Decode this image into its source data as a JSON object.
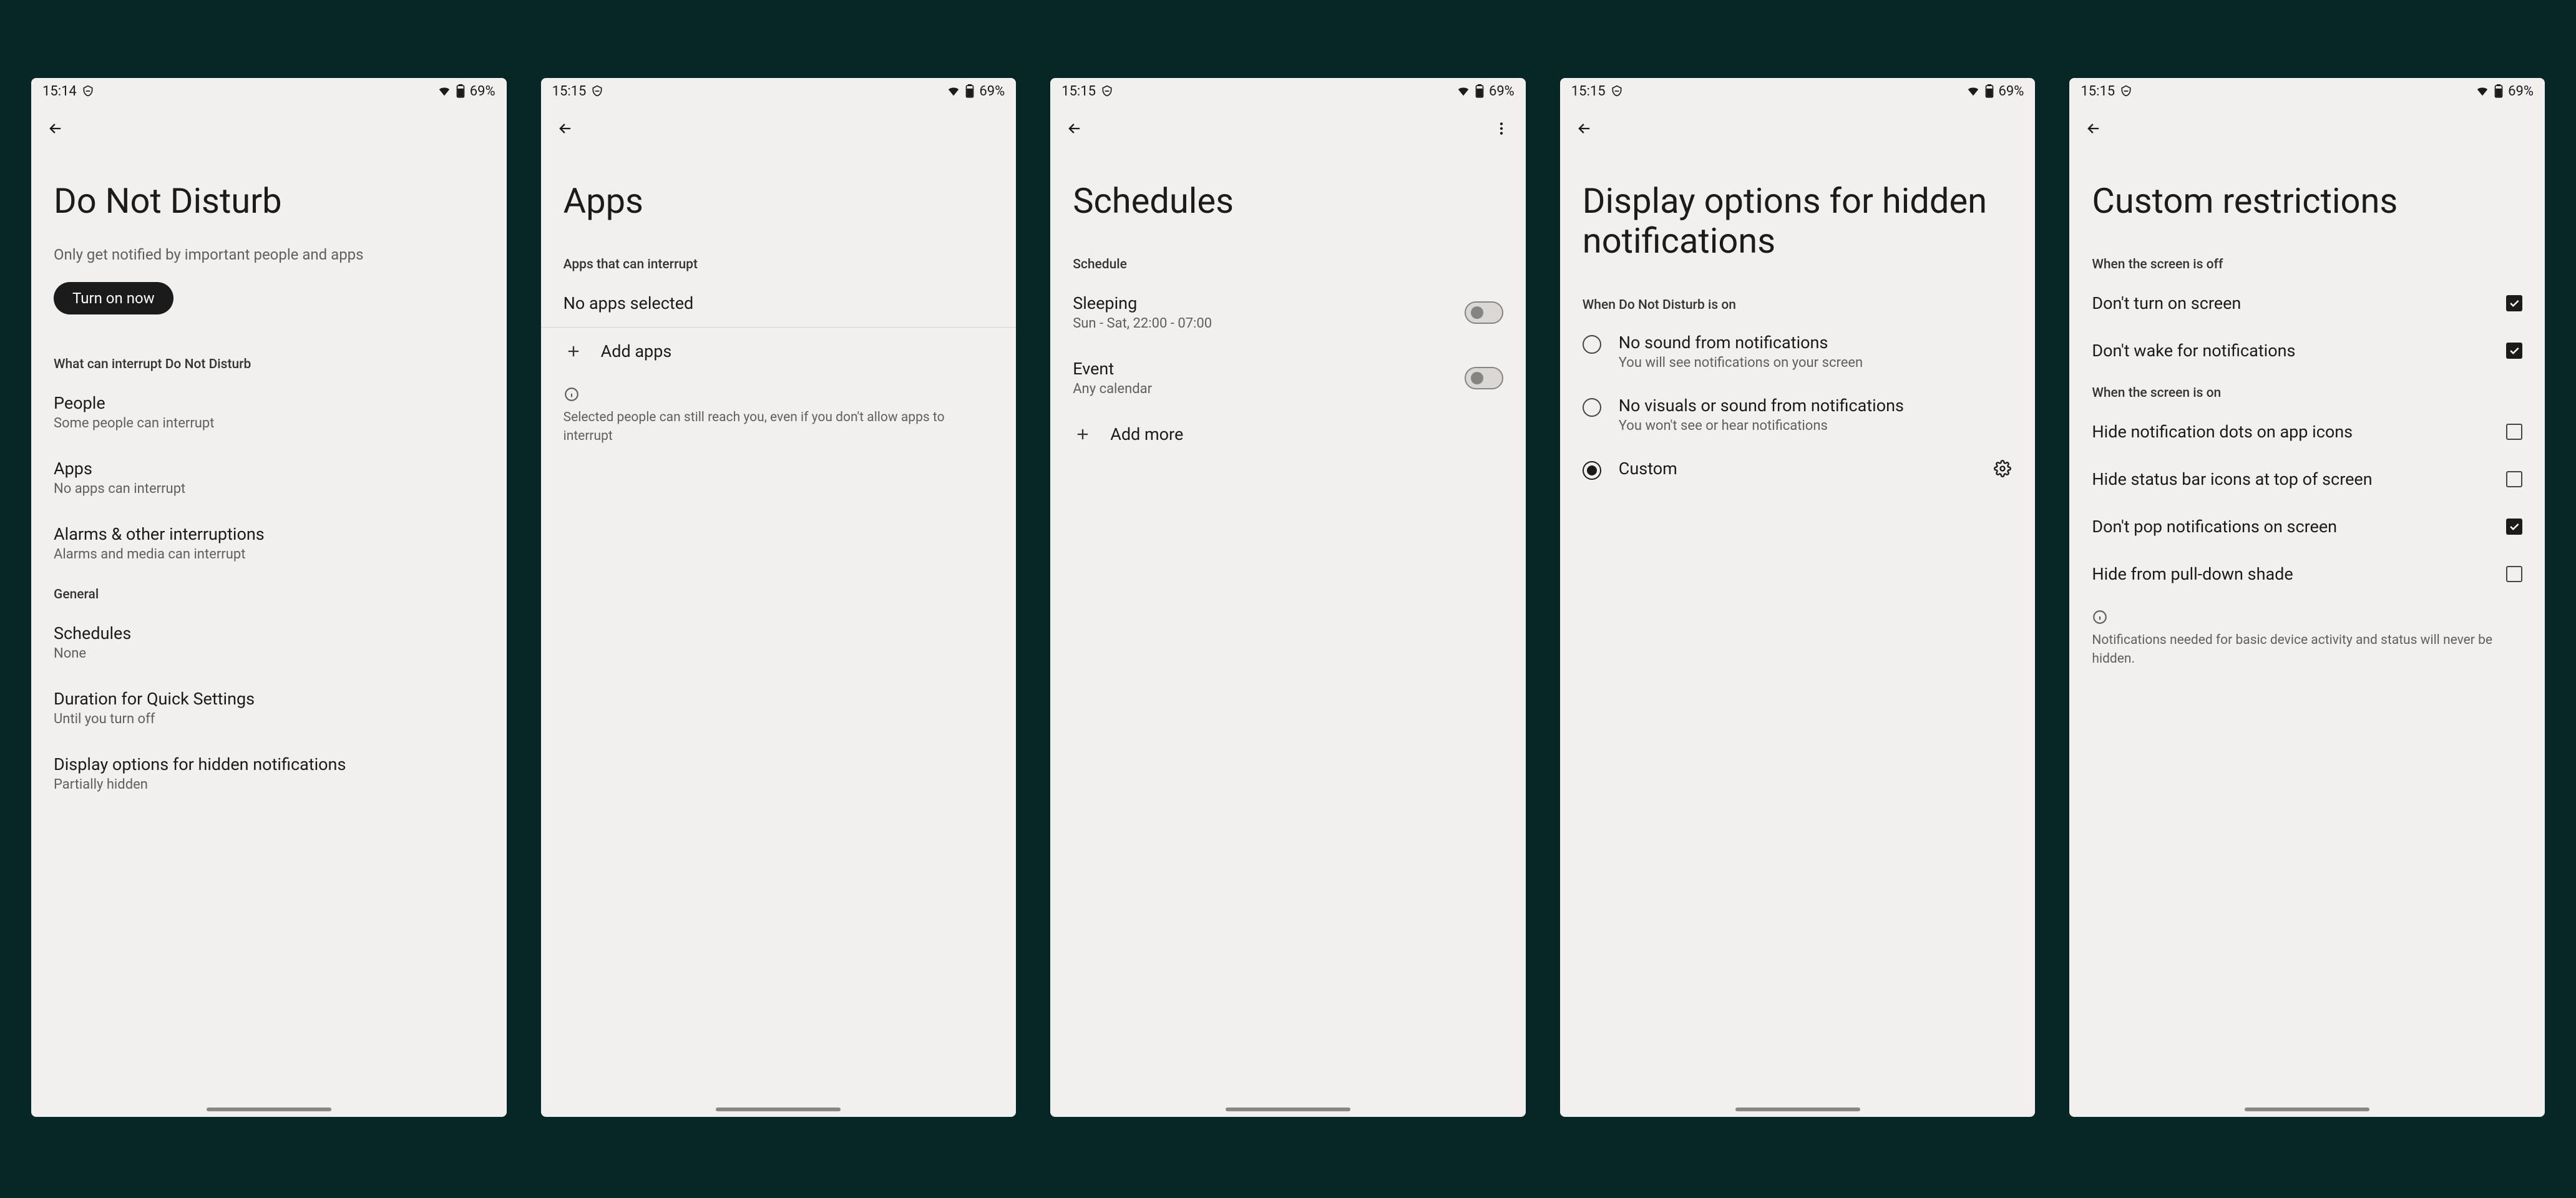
{
  "status": {
    "time1": "15:14",
    "time2": "15:15",
    "battery": "69%"
  },
  "screen1": {
    "title": "Do Not Disturb",
    "subtitle": "Only get notified by important people and apps",
    "turn_on": "Turn on now",
    "cat_interrupt": "What can interrupt Do Not Disturb",
    "people": {
      "t": "People",
      "s": "Some people can interrupt"
    },
    "apps": {
      "t": "Apps",
      "s": "No apps can interrupt"
    },
    "alarms": {
      "t": "Alarms & other interruptions",
      "s": "Alarms and media can interrupt"
    },
    "cat_general": "General",
    "schedules": {
      "t": "Schedules",
      "s": "None"
    },
    "duration": {
      "t": "Duration for Quick Settings",
      "s": "Until you turn off"
    },
    "display": {
      "t": "Display options for hidden notifications",
      "s": "Partially hidden"
    }
  },
  "screen2": {
    "title": "Apps",
    "cat": "Apps that can interrupt",
    "noapps": "No apps selected",
    "add": "Add apps",
    "note": "Selected people can still reach you, even if you don't allow apps to interrupt"
  },
  "screen3": {
    "title": "Schedules",
    "cat": "Schedule",
    "sleeping": {
      "t": "Sleeping",
      "s": "Sun - Sat, 22:00 - 07:00"
    },
    "event": {
      "t": "Event",
      "s": "Any calendar"
    },
    "addmore": "Add more"
  },
  "screen4": {
    "title": "Display options for hidden notifications",
    "cat": "When Do Not Disturb is on",
    "opt1": {
      "t": "No sound from notifications",
      "s": "You will see notifications on your screen"
    },
    "opt2": {
      "t": "No visuals or sound from notifications",
      "s": "You won't see or hear notifications"
    },
    "opt3": {
      "t": "Custom"
    }
  },
  "screen5": {
    "title": "Custom restrictions",
    "cat_off": "When the screen is off",
    "r1": "Don't turn on screen",
    "r2": "Don't wake for notifications",
    "cat_on": "When the screen is on",
    "r3": "Hide notification dots on app icons",
    "r4": "Hide status bar icons at top of screen",
    "r5": "Don't pop notifications on screen",
    "r6": "Hide from pull-down shade",
    "note": "Notifications needed for basic device activity and status will never be hidden."
  }
}
